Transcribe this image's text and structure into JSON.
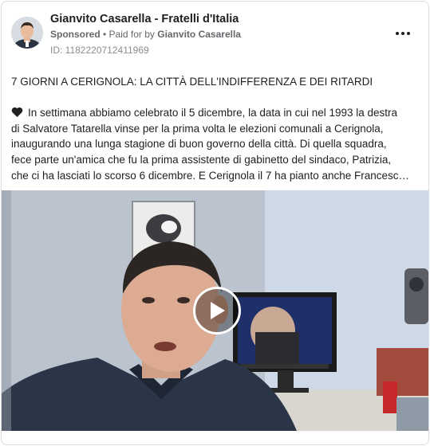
{
  "post": {
    "page_name": "Gianvito Casarella - Fratelli d'Italia",
    "sponsored_label": "Sponsored",
    "separator": " • ",
    "paid_for_prefix": "Paid for by ",
    "paid_for_name": "Gianvito Casarella",
    "ad_id": "ID: 1182220712411969",
    "headline": "7 GIORNI A CERIGNOLA: LA CITTÀ DELL'INDIFFERENZA E DEI RITARDI",
    "body_lines": [
      "In settimana abbiamo celebrato il 5 dicembre, la data in cui nel 1993 la destra",
      "di Salvatore Tatarella vinse per la prima volta le elezioni comunali a Cerignola,",
      "inaugurando una lunga stagione di buon governo della città. Di quella squadra,",
      "fece parte un'amica che fu la prima assistente di gabinetto del sindaco, Patrizia,",
      "che ci ha lasciati lo scorso 6 dicembre. E Cerignola il 7 ha pianto anche Francesc…"
    ]
  },
  "icons": {
    "avatar": "avatar",
    "heart": "black-heart-icon",
    "more": "more-options-icon",
    "play": "play-icon"
  },
  "colors": {
    "text_primary": "#1c1e21",
    "text_secondary": "#65676b",
    "border": "#dadde1"
  }
}
